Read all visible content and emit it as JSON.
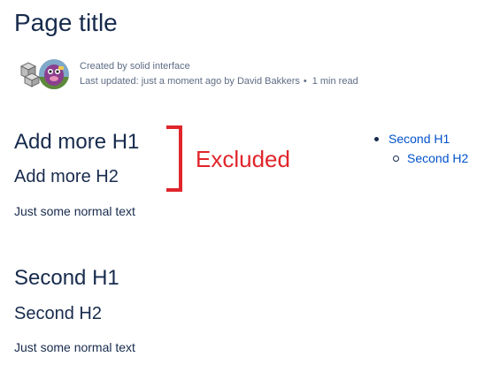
{
  "page": {
    "title": "Page title"
  },
  "byline": {
    "created_by": "Created by solid interface",
    "last_updated": "Last updated: just a moment ago by David Bakkers",
    "separator": "•",
    "read_time": "1 min read",
    "app_icon": "cube-stack-icon",
    "avatar_icon": "user-avatar"
  },
  "content": {
    "section1": {
      "h1": "Add more H1",
      "h2": "Add more H2",
      "text": "Just some normal text"
    },
    "section2": {
      "h1": "Second H1",
      "h2": "Second H2",
      "text": "Just some normal text"
    }
  },
  "annotation": {
    "label": "Excluded",
    "color": "#e0252b"
  },
  "toc": {
    "items": [
      {
        "label": "Second H1",
        "level": 1
      },
      {
        "label": "Second H2",
        "level": 2
      }
    ]
  },
  "colors": {
    "text": "#172b4d",
    "meta": "#5e6c84",
    "link": "#0052cc",
    "annotation": "#e0252b"
  }
}
